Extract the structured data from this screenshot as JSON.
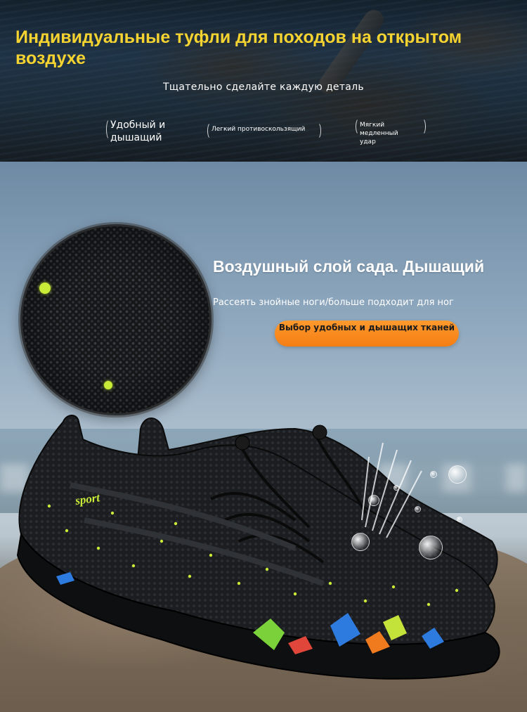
{
  "banner": {
    "title": "Индивидуальные туфли для походов на открытом воздухе",
    "subtitle": "Тщательно сделайте каждую деталь",
    "features": [
      {
        "label": "Удобный и дышащий"
      },
      {
        "label": "Легкий противоскользящий"
      },
      {
        "label": "Мягкий медленный удар"
      }
    ]
  },
  "section": {
    "heading": "Воздушный слой сада. Дышащий",
    "subheading": "Рассеять знойные ноги/больше подходит для ног",
    "badge": "Выбор удобных и дышащих тканей"
  },
  "shoe": {
    "logo_text": "sport"
  },
  "colors": {
    "title_yellow": "#f5d330",
    "badge_orange": "#f68a1e",
    "accent_green": "#c9ec38"
  }
}
